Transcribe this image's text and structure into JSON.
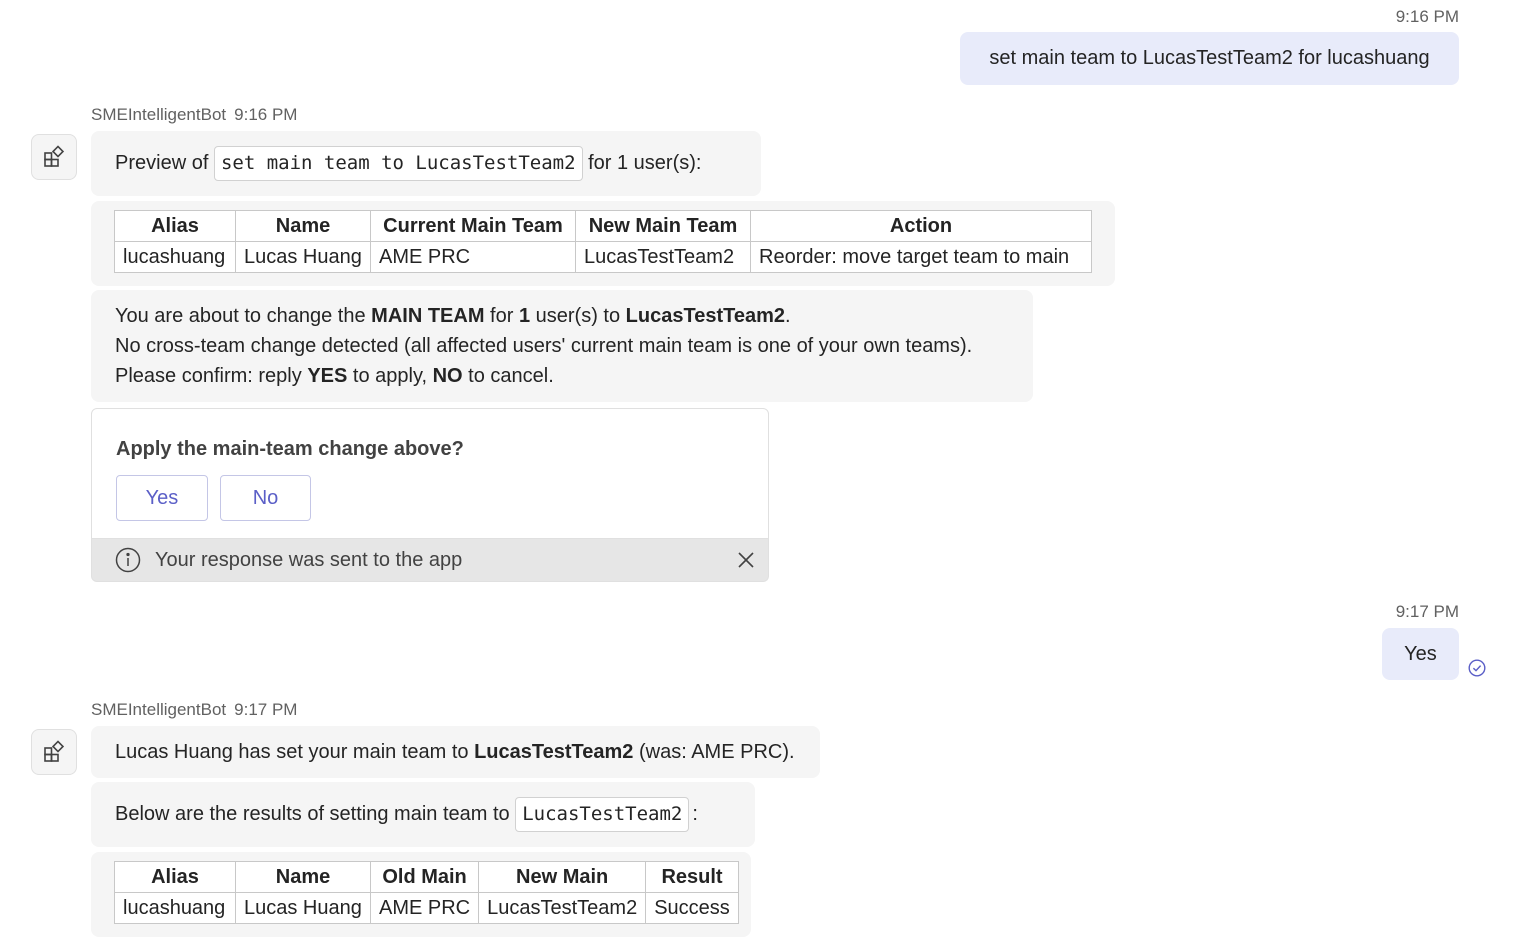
{
  "messages": {
    "user1": {
      "time": "9:16 PM",
      "text": "set main team to LucasTestTeam2 for lucashuang"
    },
    "bot1": {
      "sender": "SMEIntelligentBot",
      "time": "9:16 PM",
      "preview_prefix": "Preview of",
      "preview_code": "set main team to LucasTestTeam2",
      "preview_suffix": "for 1 user(s):",
      "table": {
        "headers": [
          "Alias",
          "Name",
          "Current Main Team",
          "New Main Team",
          "Action"
        ],
        "rows": [
          [
            "lucashuang",
            "Lucas Huang",
            "AME PRC",
            "LucasTestTeam2",
            "Reorder: move target team to main"
          ]
        ]
      },
      "confirm": {
        "l1_a": "You are about to change the",
        "l1_b": "MAIN TEAM",
        "l1_c": "for",
        "l1_d": "1",
        "l1_e": "user(s) to",
        "l1_f": "LucasTestTeam2",
        "l1_g": ".",
        "l2": "No cross-team change detected (all affected users' current main team is one of your own teams).",
        "l3_a": "Please confirm: reply",
        "l3_b": "YES",
        "l3_c": "to apply,",
        "l3_d": "NO",
        "l3_e": "to cancel."
      },
      "card": {
        "title": "Apply the main-team change above?",
        "yes_label": "Yes",
        "no_label": "No",
        "footer_text": "Your response was sent to the app"
      }
    },
    "user2": {
      "time": "9:17 PM",
      "text": "Yes"
    },
    "bot2": {
      "sender": "SMEIntelligentBot",
      "time": "9:17 PM",
      "set_a": "Lucas Huang has set your main team to",
      "set_b": "LucasTestTeam2",
      "set_c": "(was: AME PRC).",
      "results_prefix": "Below are the results of setting main team to",
      "results_code": "LucasTestTeam2",
      "results_suffix": ":",
      "table": {
        "headers": [
          "Alias",
          "Name",
          "Old Main",
          "New Main",
          "Result"
        ],
        "rows": [
          [
            "lucashuang",
            "Lucas Huang",
            "AME PRC",
            "LucasTestTeam2",
            "Success"
          ]
        ]
      }
    }
  },
  "icons": {
    "bot_avatar": "app-grid-icon",
    "info": "info-icon",
    "close": "close-icon",
    "delivered": "check-circle-icon"
  },
  "colors": {
    "user_bubble": "#e8ebfa",
    "bot_bubble": "#f5f5f5",
    "accent": "#5b5fc7"
  }
}
